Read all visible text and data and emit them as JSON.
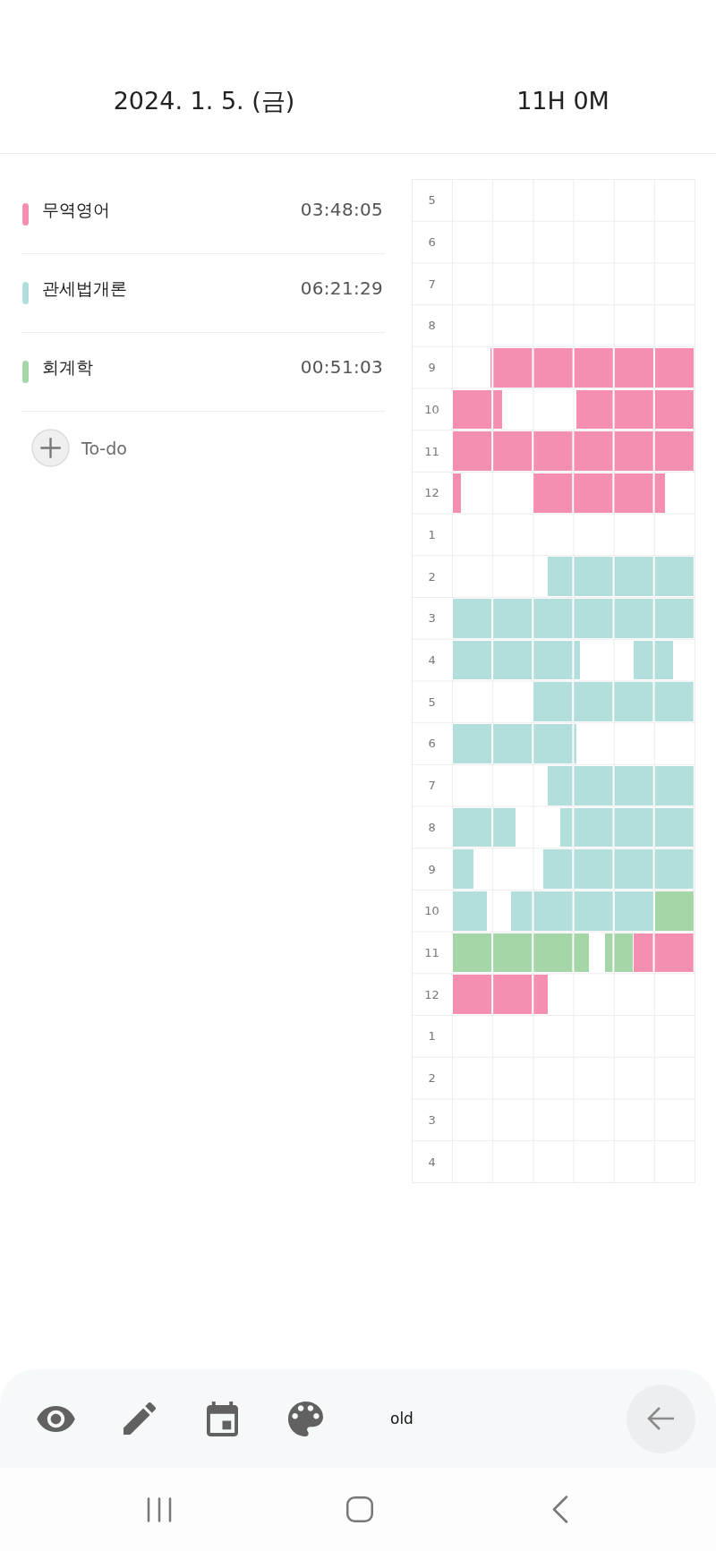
{
  "header": {
    "date": "2024. 1. 5. (금)",
    "total": "11H 0M"
  },
  "subjects": [
    {
      "name": "무역영어",
      "time": "03:48:05",
      "color": "#f48fb1"
    },
    {
      "name": "관세법개론",
      "time": "06:21:29",
      "color": "#b2dfdb"
    },
    {
      "name": "회계학",
      "time": "00:51:03",
      "color": "#a5d6a7"
    }
  ],
  "todo_button": {
    "label": "To-do"
  },
  "timetable": {
    "rows": [
      {
        "hour": "5"
      },
      {
        "hour": "6"
      },
      {
        "hour": "7"
      },
      {
        "hour": "8"
      },
      {
        "hour": "9"
      },
      {
        "hour": "10"
      },
      {
        "hour": "11"
      },
      {
        "hour": "12"
      },
      {
        "hour": "1"
      },
      {
        "hour": "2"
      },
      {
        "hour": "3"
      },
      {
        "hour": "4"
      },
      {
        "hour": "5"
      },
      {
        "hour": "6"
      },
      {
        "hour": "7"
      },
      {
        "hour": "8"
      },
      {
        "hour": "9"
      },
      {
        "hour": "10"
      },
      {
        "hour": "11"
      },
      {
        "hour": "12"
      },
      {
        "hour": "1"
      },
      {
        "hour": "2"
      },
      {
        "hour": "3"
      },
      {
        "hour": "4"
      }
    ]
  },
  "toolbar": {
    "mode_label": "old"
  }
}
